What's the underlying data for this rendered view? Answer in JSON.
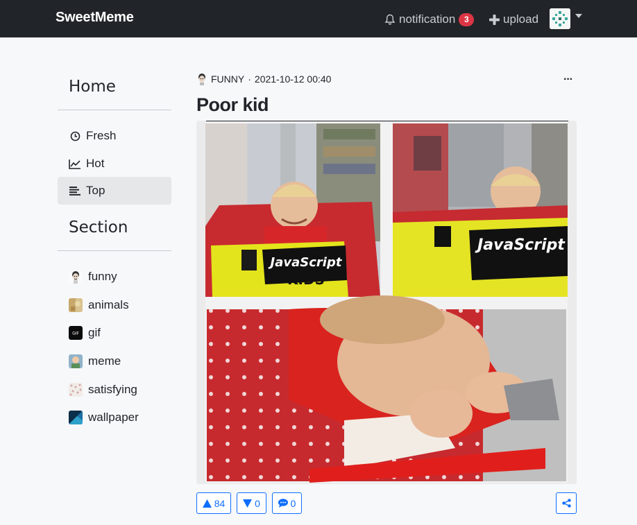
{
  "navbar": {
    "brand": "SweetMeme",
    "notification_label": "notification",
    "notification_count": "3",
    "upload_label": "upload",
    "icons": [
      "bell-icon",
      "plus-icon",
      "avatar",
      "caret-down-icon"
    ]
  },
  "sidebar": {
    "home_heading": "Home",
    "nav_items": [
      {
        "label": "Fresh",
        "icon": "clock-icon",
        "active": false
      },
      {
        "label": "Hot",
        "icon": "line-chart-icon",
        "active": false
      },
      {
        "label": "Top",
        "icon": "bars-icon",
        "active": true
      }
    ],
    "section_heading": "Section",
    "sections": [
      {
        "label": "funny"
      },
      {
        "label": "animals"
      },
      {
        "label": "gif"
      },
      {
        "label": "meme"
      },
      {
        "label": "satisfying"
      },
      {
        "label": "wallpaper"
      }
    ]
  },
  "post": {
    "section": "FUNNY",
    "separator": "·",
    "timestamp": "2021-10-12 00:40",
    "more_label": "···",
    "title": "Poor kid",
    "book_title_1": "JavaScript",
    "book_title_2": "KIDS",
    "upvotes": "84",
    "downvotes": "0",
    "comments": "0"
  },
  "colors": {
    "navbar_bg": "#212529",
    "accent": "#0d6efd",
    "badge": "#dc3545",
    "page_bg": "#f7f8fa"
  }
}
